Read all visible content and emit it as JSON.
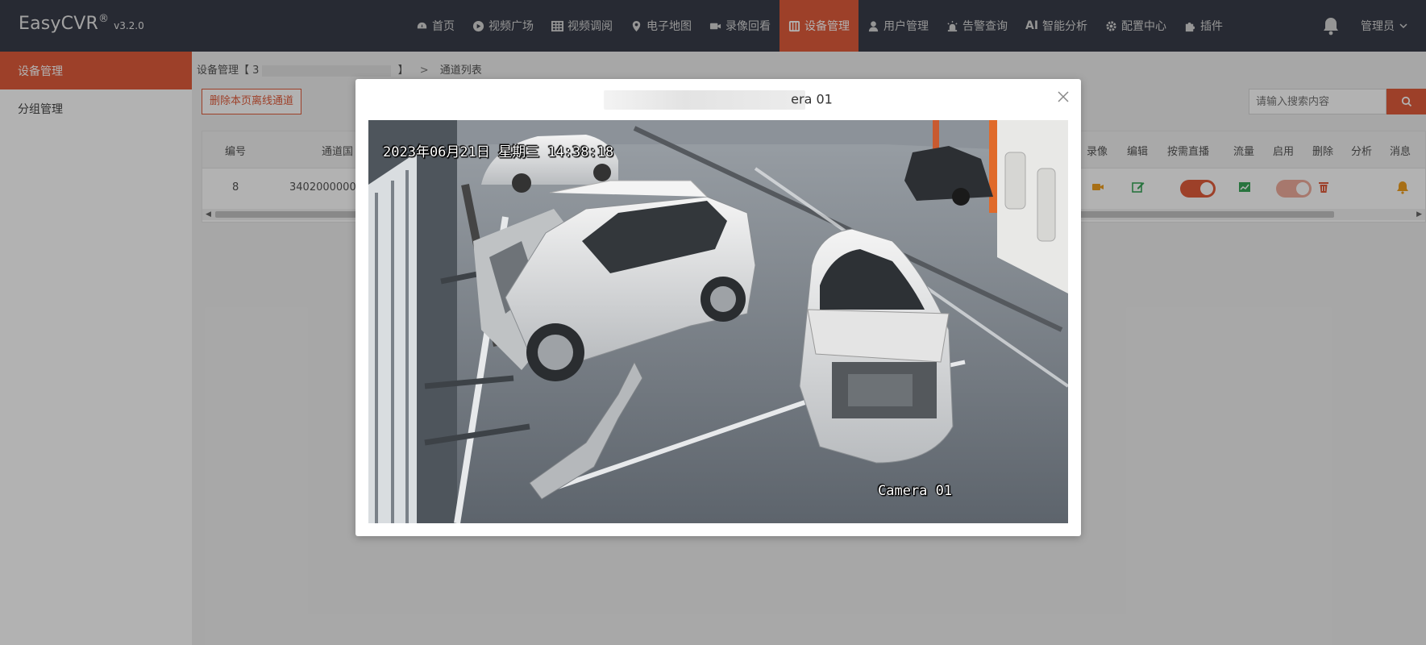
{
  "app": {
    "brand": "EasyCVR",
    "reg": "®",
    "version": "v3.2.0"
  },
  "nav": [
    {
      "label": "首页",
      "icon": "dashboard-icon"
    },
    {
      "label": "视频广场",
      "icon": "play-circle-icon"
    },
    {
      "label": "视频调阅",
      "icon": "grid-icon"
    },
    {
      "label": "电子地图",
      "icon": "map-pin-icon"
    },
    {
      "label": "录像回看",
      "icon": "video-camera-icon"
    },
    {
      "label": "设备管理",
      "icon": "device-icon",
      "active": true
    },
    {
      "label": "用户管理",
      "icon": "user-icon"
    },
    {
      "label": "告警查询",
      "icon": "alarm-icon"
    },
    {
      "label": "智能分析",
      "icon": "ai-icon",
      "prefix": "AI"
    },
    {
      "label": "配置中心",
      "icon": "gear-icon"
    },
    {
      "label": "插件",
      "icon": "puzzle-icon"
    }
  ],
  "user": {
    "label": "管理员"
  },
  "sidebar": {
    "items": [
      {
        "label": "设备管理",
        "active": true
      },
      {
        "label": "分组管理",
        "active": false
      }
    ]
  },
  "breadcrumb": {
    "root": "设备管理【",
    "id_prefix": "3",
    "close": "】",
    "separator": ">",
    "current": "通道列表"
  },
  "toolbar": {
    "delete_offline_label": "删除本页离线通道",
    "search_placeholder": "请输入搜索内容"
  },
  "table": {
    "headers_left": [
      "编号",
      "通道国"
    ],
    "headers_right": [
      "录像",
      "编辑",
      "按需直播",
      "流量",
      "启用",
      "删除",
      "分析",
      "消息"
    ],
    "row": {
      "no": "8",
      "channel_id": "3402000000"
    }
  },
  "modal": {
    "title_suffix": "era 01",
    "video": {
      "timestamp": "2023年06月21日 星期三 14:38:18",
      "camera_label": "Camera 01"
    }
  },
  "colors": {
    "accent": "#e15c3b",
    "topbar": "#393d49",
    "green": "#3aa65a",
    "orange": "#f0a020"
  }
}
